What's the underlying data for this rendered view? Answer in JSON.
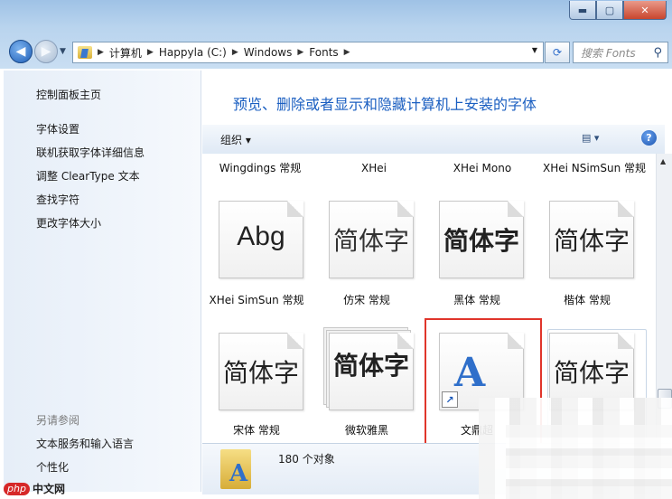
{
  "window": {
    "caption_buttons": [
      "minimize",
      "maximize",
      "close"
    ]
  },
  "nav": {
    "breadcrumbs": [
      "计算机",
      "Happyla (C:)",
      "Windows",
      "Fonts"
    ],
    "search_placeholder": "搜索 Fonts"
  },
  "sidebar": {
    "home": "控制面板主页",
    "links": [
      "字体设置",
      "联机获取字体详细信息",
      "调整 ClearType 文本",
      "查找字符",
      "更改字体大小"
    ],
    "see_also_heading": "另请参阅",
    "see_also": [
      "文本服务和输入语言",
      "个性化"
    ]
  },
  "main": {
    "title": "预览、删除或者显示和隐藏计算机上安装的字体",
    "toolbar": {
      "organize": "组织 ▾",
      "view": "▤ ▾",
      "help": "?"
    }
  },
  "fonts": {
    "row0": [
      "Wingdings 常规",
      "XHei",
      "XHei Mono",
      "XHei NSimSun 常规"
    ],
    "row1": [
      {
        "glyph": "Abg",
        "label": "XHei SimSun 常规"
      },
      {
        "glyph": "简体字",
        "label": "仿宋 常规"
      },
      {
        "glyph": "简体字",
        "label": "黑体 常规"
      },
      {
        "glyph": "简体字",
        "label": "楷体 常规"
      }
    ],
    "row2": [
      {
        "glyph": "简体字",
        "label": "宋体 常规"
      },
      {
        "glyph": "简体字",
        "label": "微软雅黑"
      },
      {
        "glyph": "A",
        "label": "文鼎超"
      },
      {
        "glyph": "简体字",
        "label": ""
      }
    ]
  },
  "details": {
    "count": "180 个对象"
  },
  "watermark": {
    "php": "php",
    "cn": "中文网"
  },
  "colors": {
    "link_blue": "#1b5fc1",
    "highlight_red": "#e0352b"
  }
}
